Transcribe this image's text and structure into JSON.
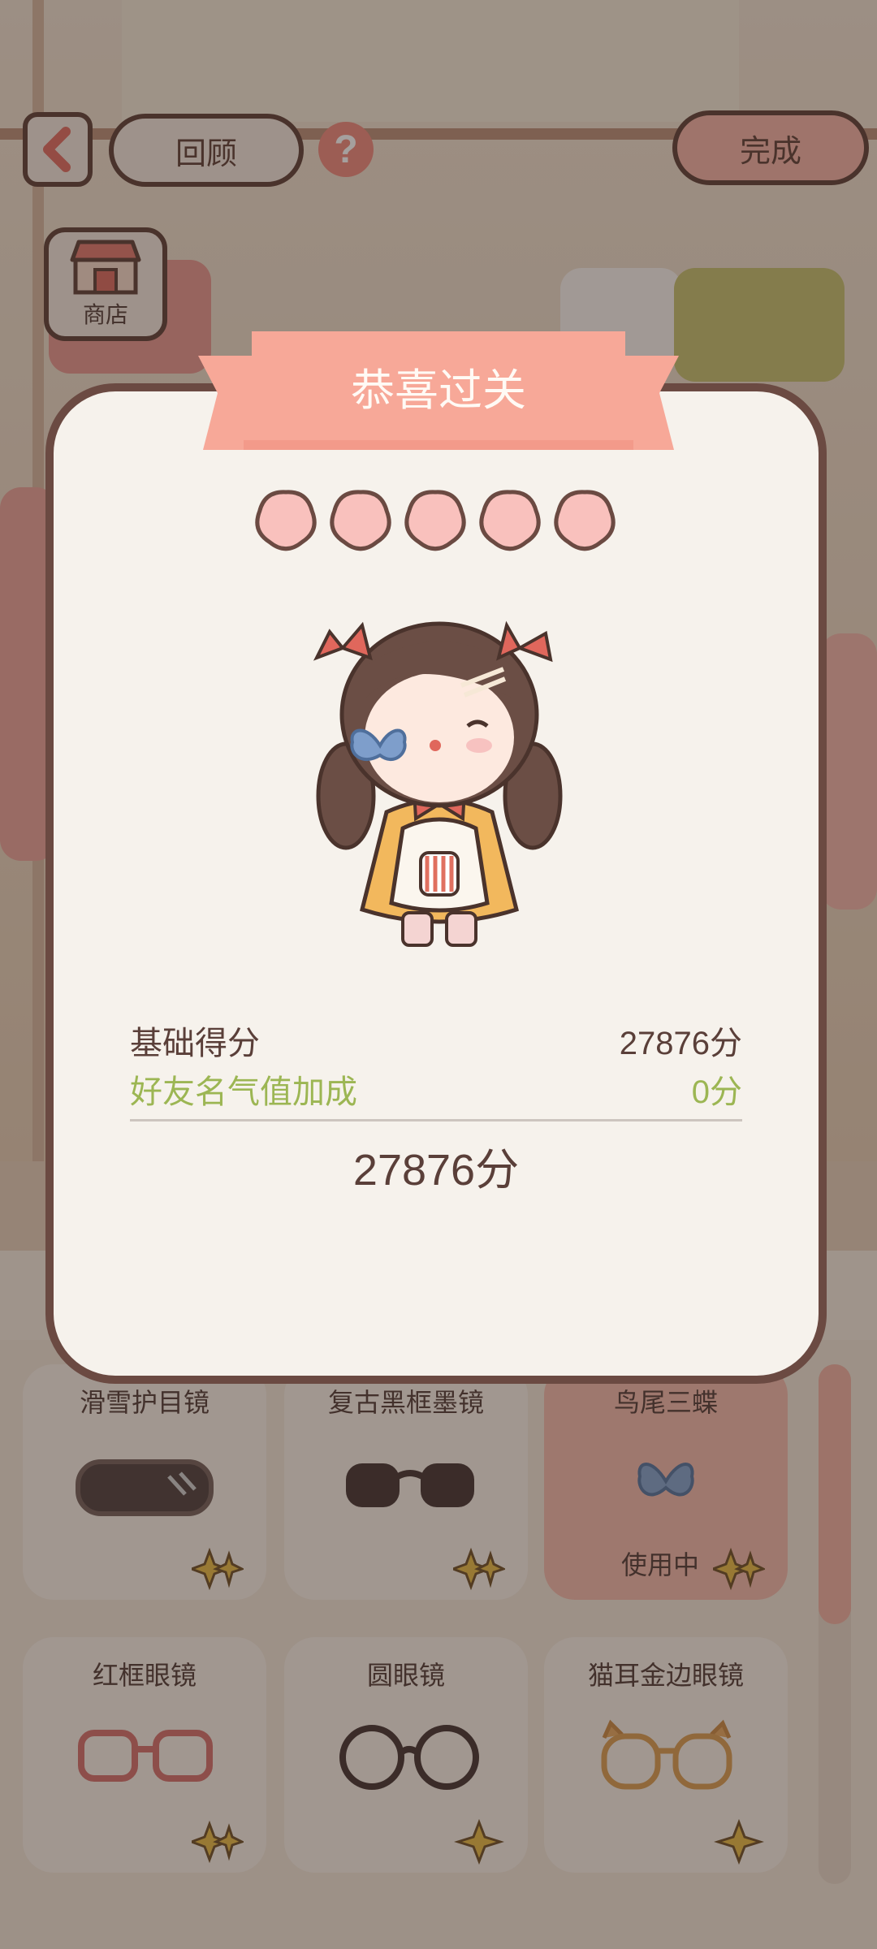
{
  "topbar": {
    "back_icon": "chevron-left-icon",
    "review_label": "回顾",
    "help_icon": "question-icon",
    "done_label": "完成"
  },
  "shop": {
    "label": "商店",
    "icon": "shop-icon"
  },
  "modal": {
    "title": "恭喜过关",
    "stars": 5,
    "stars_max": 5,
    "base_score_label": "基础得分",
    "base_score_value": "27876分",
    "bonus_label": "好友名气值加成",
    "bonus_value": "0分",
    "total_value": "27876分"
  },
  "items": [
    {
      "name": "滑雪护目镜",
      "icon": "ski-goggles-icon",
      "status": ""
    },
    {
      "name": "复古黑框墨镜",
      "icon": "sunglasses-icon",
      "status": ""
    },
    {
      "name": "鸟尾三蝶",
      "icon": "butterfly-clip-icon",
      "status": "使用中"
    },
    {
      "name": "红框眼镜",
      "icon": "red-glasses-icon",
      "status": ""
    },
    {
      "name": "圆眼镜",
      "icon": "round-glasses-icon",
      "status": ""
    },
    {
      "name": "猫耳金边眼镜",
      "icon": "cat-ear-glasses-icon",
      "status": ""
    }
  ],
  "colors": {
    "ribbon": "#f7a898",
    "star": "#f9c1bd",
    "outline": "#6b4a42",
    "bonus_green": "#9cb653",
    "text_brown": "#5a3f39",
    "sparkle_gold": "#e7b93f"
  }
}
